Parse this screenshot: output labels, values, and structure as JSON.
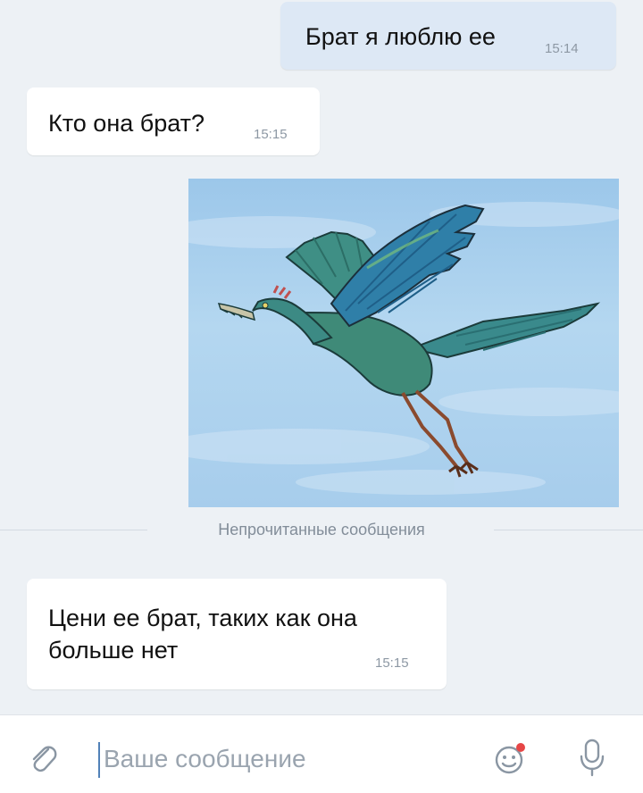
{
  "messages": [
    {
      "direction": "out",
      "text": "Брат я люблю ее",
      "time": "15:14"
    },
    {
      "direction": "in",
      "text": "Кто она брат?",
      "time": "15:15"
    },
    {
      "direction": "out",
      "type": "photo",
      "subject": "archaeopteryx illustration"
    },
    {
      "direction": "in",
      "text": "Цени ее брат, таких как она больше нет",
      "time": "15:15"
    }
  ],
  "unread_divider": "Непрочитанные сообщения",
  "composer": {
    "placeholder": "Ваше сообщение",
    "attach_icon": "paperclip-icon",
    "emoji_icon": "smile-icon",
    "mic_icon": "microphone-icon"
  },
  "colors": {
    "background": "#edf1f5",
    "outgoing_bubble": "#dde8f5",
    "incoming_bubble": "#ffffff",
    "accent": "#5181b8",
    "notification_dot": "#e64646"
  }
}
